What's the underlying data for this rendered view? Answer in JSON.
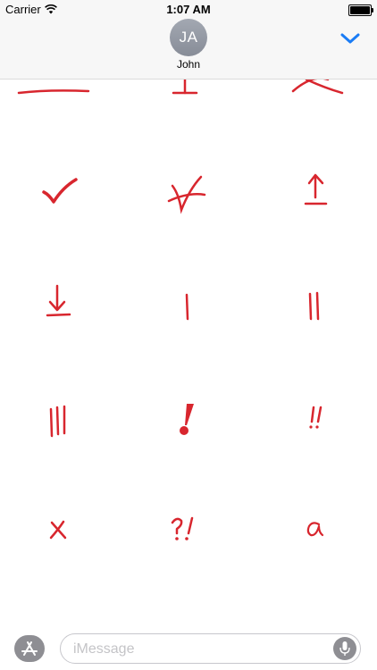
{
  "status_bar": {
    "carrier": "Carrier",
    "time": "1:07 AM",
    "battery_level": 1.0
  },
  "header": {
    "avatar_initials": "JA",
    "contact_name": "John",
    "collapse_icon": "chevron-down-icon"
  },
  "stickers": [
    {
      "name": "sticker-underline",
      "icon": "horizontal-stroke"
    },
    {
      "name": "sticker-up-tack",
      "icon": "up-tack"
    },
    {
      "name": "sticker-x-mark-top",
      "icon": "x-stroke"
    },
    {
      "name": "sticker-check-mark",
      "icon": "check-mark"
    },
    {
      "name": "sticker-crossed-check",
      "icon": "crossed-check"
    },
    {
      "name": "sticker-up-arrow",
      "icon": "up-arrow-to-bar"
    },
    {
      "name": "sticker-down-arrow",
      "icon": "down-arrow-to-bar"
    },
    {
      "name": "sticker-one-stroke",
      "icon": "tally-1"
    },
    {
      "name": "sticker-two-strokes",
      "icon": "tally-2"
    },
    {
      "name": "sticker-three-strokes",
      "icon": "tally-3"
    },
    {
      "name": "sticker-exclamation",
      "icon": "exclamation"
    },
    {
      "name": "sticker-double-exclamation",
      "icon": "double-exclamation"
    },
    {
      "name": "sticker-x",
      "icon": "x-letter"
    },
    {
      "name": "sticker-interrobang",
      "icon": "question-exclamation"
    },
    {
      "name": "sticker-letter-a",
      "icon": "a-letter"
    }
  ],
  "sticker_color": "#d8262e",
  "input_bar": {
    "app_store_icon": "app-store-icon",
    "placeholder": "iMessage",
    "mic_icon": "microphone-icon"
  }
}
